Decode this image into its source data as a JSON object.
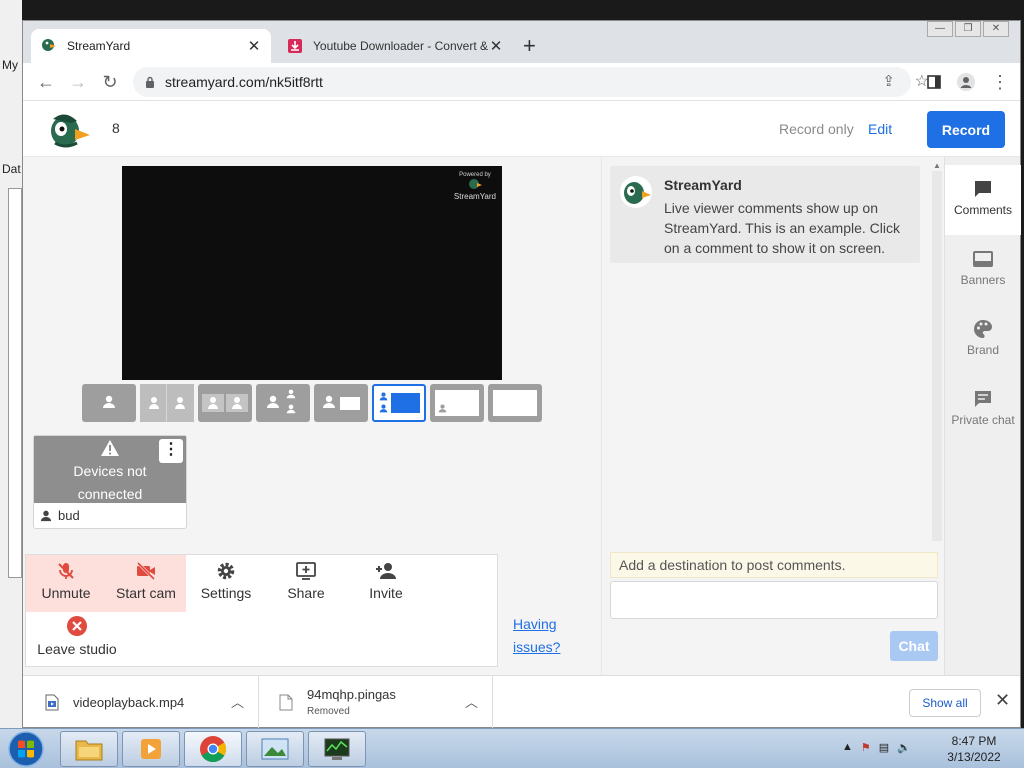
{
  "desktop": {
    "labels": [
      "My",
      "Dat"
    ]
  },
  "browser": {
    "tabs": [
      {
        "title": "StreamYard",
        "active": true
      },
      {
        "title": "Youtube Downloader - Convert & ",
        "active": false
      }
    ],
    "url": "streamyard.com/nk5itf8rtt",
    "window_controls": [
      "minimize",
      "restore",
      "close"
    ]
  },
  "header": {
    "count": "8",
    "record_only_label": "Record only",
    "edit_label": "Edit",
    "record_button": "Record"
  },
  "stage": {
    "powered_by": "Powered by",
    "brand": "StreamYard"
  },
  "layouts": [
    "solo",
    "split-2",
    "group",
    "sidebar-2",
    "single-screen",
    "speaker-screen",
    "thumb-screen",
    "full-screen"
  ],
  "guest": {
    "status_line1": "Devices not",
    "status_line2": "connected",
    "name": "bud"
  },
  "controls": {
    "unmute": "Unmute",
    "start_cam": "Start cam",
    "settings": "Settings",
    "share": "Share",
    "invite": "Invite",
    "leave": "Leave studio"
  },
  "help": {
    "line1": "Having",
    "line2": "issues?"
  },
  "chat": {
    "comment_author": "StreamYard",
    "comment_text": "Live viewer comments show up on StreamYard. This is an example. Click on a comment to show it on screen.",
    "destination_note": "Add a destination to post comments.",
    "input_value": "",
    "chat_button": "Chat"
  },
  "side_panel": {
    "items": [
      "Comments",
      "Banners",
      "Brand",
      "Private chat"
    ],
    "active": "Comments"
  },
  "downloads": [
    {
      "name": "videoplayback.mp4",
      "status": ""
    },
    {
      "name": "94mqhp.pingas",
      "status": "Removed"
    }
  ],
  "download_bar": {
    "show_all": "Show all"
  },
  "taskbar": {
    "time": "8:47 PM",
    "date": "3/13/2022",
    "apps": [
      "explorer",
      "media-player",
      "chrome",
      "image-viewer",
      "task-manager"
    ]
  },
  "colors": {
    "accent": "#1f6fe5",
    "danger_bg": "#fde0dc",
    "danger_icon": "#e04a3f",
    "chat_button_disabled": "#a9c8f2"
  }
}
